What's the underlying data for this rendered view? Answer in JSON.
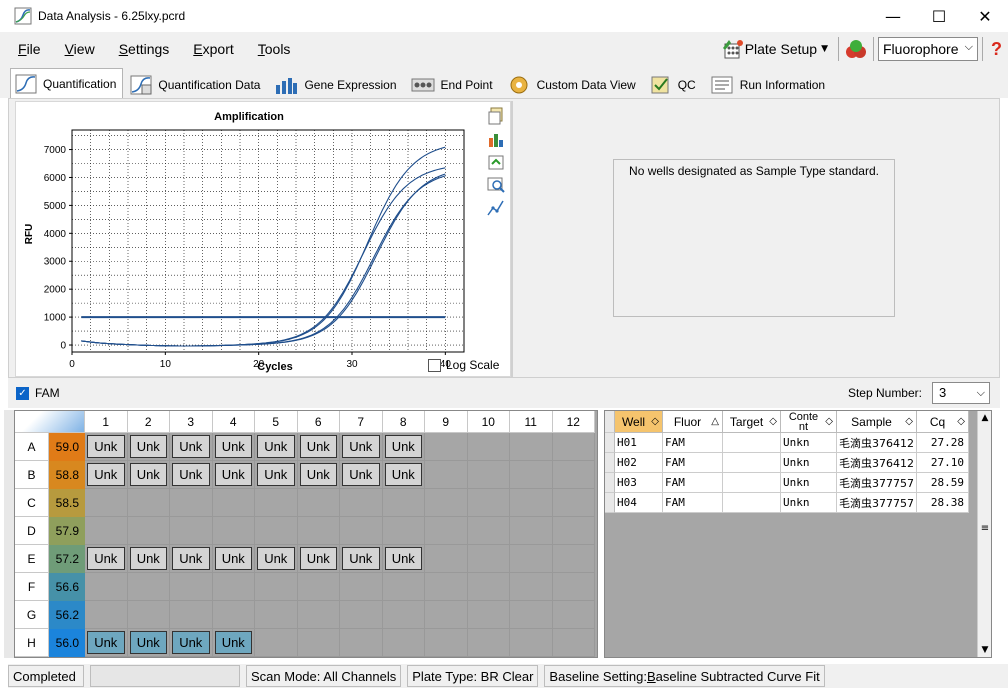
{
  "window": {
    "title": "Data Analysis - 6.25lxy.pcrd",
    "minimize": "—",
    "maximize": "☐",
    "close": "✕"
  },
  "menu": [
    {
      "label": "File",
      "u": "F",
      "rest": "ile"
    },
    {
      "label": "View",
      "u": "V",
      "rest": "iew"
    },
    {
      "label": "Settings",
      "u": "S",
      "rest": "ettings"
    },
    {
      "label": "Export",
      "u": "E",
      "rest": "xport"
    },
    {
      "label": "Tools",
      "u": "T",
      "rest": "ools"
    }
  ],
  "toolbar": {
    "plate_setup": "Plate Setup",
    "fluorophore": "Fluorophore",
    "help": "?"
  },
  "tabs": [
    {
      "label": "Quantification",
      "active": true
    },
    {
      "label": "Quantification Data",
      "active": false
    },
    {
      "label": "Gene Expression",
      "active": false
    },
    {
      "label": "End Point",
      "active": false
    },
    {
      "label": "Custom Data View",
      "active": false
    },
    {
      "label": "QC",
      "active": false
    },
    {
      "label": "Run Information",
      "active": false
    }
  ],
  "chart_data": {
    "type": "line",
    "title": "Amplification",
    "xlabel": "Cycles",
    "ylabel": "RFU",
    "xlim": [
      0,
      42
    ],
    "ylim": [
      -250,
      7700
    ],
    "xticks": [
      0,
      10,
      20,
      30,
      40
    ],
    "yticks": [
      0,
      1000,
      2000,
      3000,
      4000,
      5000,
      6000,
      7000
    ],
    "grid": true,
    "threshold": 1000,
    "series": [
      {
        "well": "H01",
        "cq": 27.28,
        "plateau": 7300
      },
      {
        "well": "H02",
        "cq": 27.1,
        "plateau": 6500
      },
      {
        "well": "H03",
        "cq": 28.59,
        "plateau": 6400
      },
      {
        "well": "H04",
        "cq": 28.38,
        "plateau": 6300
      }
    ]
  },
  "log_scale_label": "Log Scale",
  "standard_message": "No wells designated as Sample Type standard.",
  "fam_label": "FAM",
  "step": {
    "label": "Step Number:",
    "value": "3"
  },
  "plate": {
    "columns": [
      "1",
      "2",
      "3",
      "4",
      "5",
      "6",
      "7",
      "8",
      "9",
      "10",
      "11",
      "12"
    ],
    "rows": [
      {
        "label": "A",
        "temp": "59.0",
        "color": "#e07b17",
        "wells": 8,
        "selected": false
      },
      {
        "label": "B",
        "temp": "58.8",
        "color": "#d8881f",
        "wells": 8,
        "selected": false
      },
      {
        "label": "C",
        "temp": "58.5",
        "color": "#b79a3e",
        "wells": 0,
        "selected": false
      },
      {
        "label": "D",
        "temp": "57.9",
        "color": "#8f9f5c",
        "wells": 0,
        "selected": false
      },
      {
        "label": "E",
        "temp": "57.2",
        "color": "#6f9c78",
        "wells": 8,
        "selected": false
      },
      {
        "label": "F",
        "temp": "56.6",
        "color": "#4691a8",
        "wells": 0,
        "selected": false
      },
      {
        "label": "G",
        "temp": "56.2",
        "color": "#2c89c8",
        "wells": 0,
        "selected": false
      },
      {
        "label": "H",
        "temp": "56.0",
        "color": "#1b84dc",
        "wells": 4,
        "selected": true
      }
    ],
    "well_label": "Unk"
  },
  "table": {
    "headers": [
      "Well",
      "Fluor",
      "Target",
      "Content",
      "Sample",
      "Cq"
    ],
    "rows": [
      [
        "H01",
        "FAM",
        "",
        "Unkn",
        "毛滴虫376412",
        "27.28"
      ],
      [
        "H02",
        "FAM",
        "",
        "Unkn",
        "毛滴虫376412",
        "27.10"
      ],
      [
        "H03",
        "FAM",
        "",
        "Unkn",
        "毛滴虫377757",
        "28.59"
      ],
      [
        "H04",
        "FAM",
        "",
        "Unkn",
        "毛滴虫377757",
        "28.38"
      ]
    ]
  },
  "status": {
    "completed": "Completed",
    "scan_mode": "Scan Mode: All Channels",
    "plate_type": "Plate Type: BR Clear",
    "baseline_pre": "Baseline Setting: ",
    "baseline_u": "B",
    "baseline_rest": "aseline Subtracted Curve Fit"
  },
  "colors": {
    "curve": "#1f4e8c",
    "threshold": "#1f4e8c",
    "selected_well": "#6ea7bf",
    "active_header": "#f5c46d"
  }
}
